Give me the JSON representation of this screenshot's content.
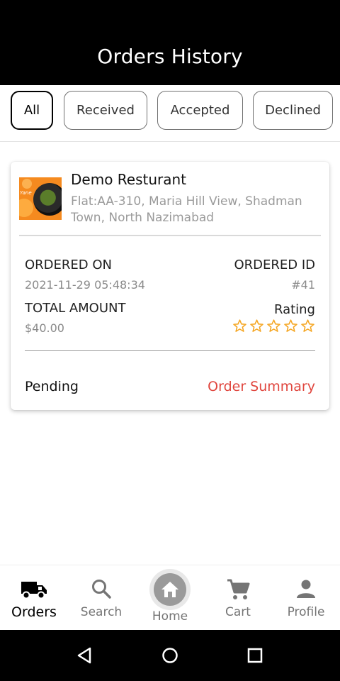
{
  "header": {
    "title": "Orders History"
  },
  "filters": [
    {
      "label": "All",
      "active": true
    },
    {
      "label": "Received",
      "active": false
    },
    {
      "label": "Accepted",
      "active": false
    },
    {
      "label": "Declined",
      "active": false
    }
  ],
  "order": {
    "restaurant_name": "Demo Resturant",
    "address": "Flat:AA-310, Maria Hill View, Shadman Town, North Nazimabad",
    "thumb_text": "Yane",
    "ordered_on_label": "ORDERED ON",
    "ordered_on_value": "2021-11-29 05:48:34",
    "ordered_id_label": "ORDERED ID",
    "ordered_id_value": "#41",
    "total_label": "TOTAL AMOUNT",
    "total_value": "$40.00",
    "rating_label": "Rating",
    "rating": 0,
    "rating_max": 5,
    "status": "Pending",
    "summary_link": "Order Summary"
  },
  "nav": [
    {
      "label": "Orders",
      "icon": "truck-icon",
      "active": true
    },
    {
      "label": "Search",
      "icon": "search-icon",
      "active": false
    },
    {
      "label": "Home",
      "icon": "home-icon",
      "active": false
    },
    {
      "label": "Cart",
      "icon": "cart-icon",
      "active": false
    },
    {
      "label": "Profile",
      "icon": "person-icon",
      "active": false
    }
  ],
  "system_nav": [
    "back-icon",
    "home-circle-icon",
    "recents-icon"
  ],
  "colors": {
    "header_bg": "#000000",
    "accent_red": "#e0463e",
    "star": "#f5a623",
    "muted_text": "#8a8a8a"
  }
}
